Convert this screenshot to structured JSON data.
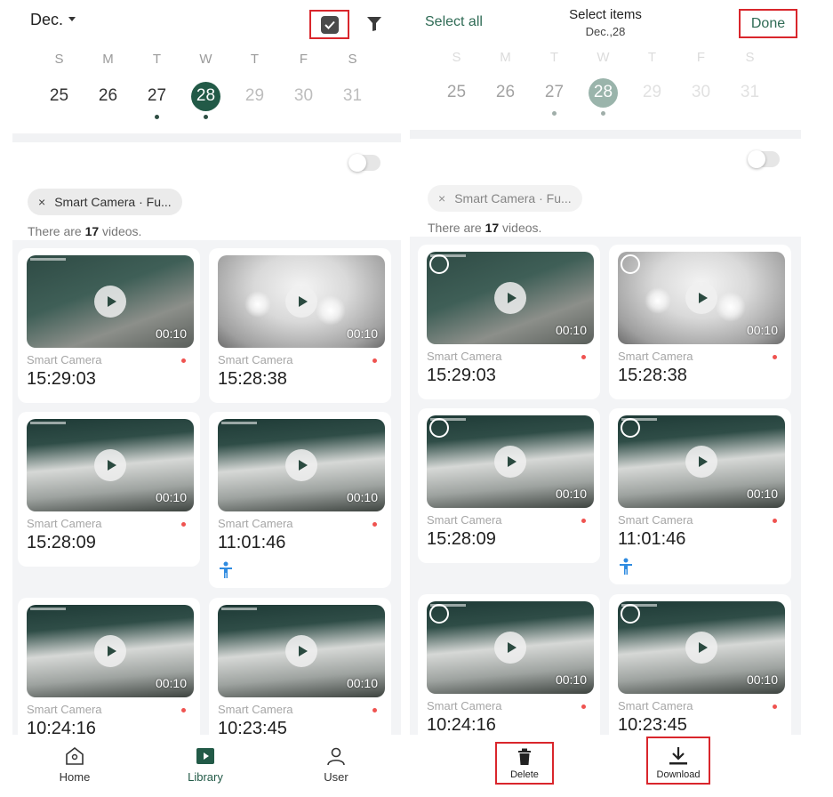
{
  "left": {
    "header": {
      "month": "Dec."
    },
    "calendar": {
      "weekdays": [
        "S",
        "M",
        "T",
        "W",
        "T",
        "F",
        "S"
      ],
      "dates": [
        "25",
        "26",
        "27",
        "28",
        "29",
        "30",
        "31"
      ]
    },
    "filter_chip": {
      "close": "×",
      "label": "Smart Camera · Fu..."
    },
    "count": {
      "prefix": "There are ",
      "number": "17",
      "suffix": " videos."
    },
    "videos": [
      {
        "camera": "Smart Camera",
        "time": "15:29:03",
        "duration": "00:10"
      },
      {
        "camera": "Smart Camera",
        "time": "15:28:38",
        "duration": "00:10"
      },
      {
        "camera": "Smart Camera",
        "time": "15:28:09",
        "duration": "00:10"
      },
      {
        "camera": "Smart Camera",
        "time": "11:01:46",
        "duration": "00:10"
      },
      {
        "camera": "Smart Camera",
        "time": "10:24:16",
        "duration": "00:10"
      },
      {
        "camera": "Smart Camera",
        "time": "10:23:45",
        "duration": "00:10"
      }
    ],
    "nav": [
      {
        "label": "Home",
        "icon": "home-icon"
      },
      {
        "label": "Library",
        "icon": "library-icon"
      },
      {
        "label": "User",
        "icon": "user-icon"
      }
    ]
  },
  "right": {
    "header": {
      "select_all": "Select all",
      "title": "Select items",
      "subtitle": "Dec.,28",
      "done": "Done"
    },
    "calendar": {
      "weekdays": [
        "S",
        "M",
        "T",
        "W",
        "T",
        "F",
        "S"
      ],
      "dates": [
        "25",
        "26",
        "27",
        "28",
        "29",
        "30",
        "31"
      ]
    },
    "filter_chip": {
      "close": "×",
      "label": "Smart Camera · Fu..."
    },
    "count": {
      "prefix": "There are ",
      "number": "17",
      "suffix": " videos."
    },
    "videos": [
      {
        "camera": "Smart Camera",
        "time": "15:29:03",
        "duration": "00:10"
      },
      {
        "camera": "Smart Camera",
        "time": "15:28:38",
        "duration": "00:10"
      },
      {
        "camera": "Smart Camera",
        "time": "15:28:09",
        "duration": "00:10"
      },
      {
        "camera": "Smart Camera",
        "time": "11:01:46",
        "duration": "00:10"
      },
      {
        "camera": "Smart Camera",
        "time": "10:24:16",
        "duration": "00:10"
      },
      {
        "camera": "Smart Camera",
        "time": "10:23:45",
        "duration": "00:10"
      }
    ],
    "actions": {
      "delete": "Delete",
      "download": "Download"
    }
  },
  "colors": {
    "accent": "#225a47",
    "highlight_box": "#d9262c",
    "record_dot": "#ef5350",
    "person_icon": "#2f8be0"
  }
}
